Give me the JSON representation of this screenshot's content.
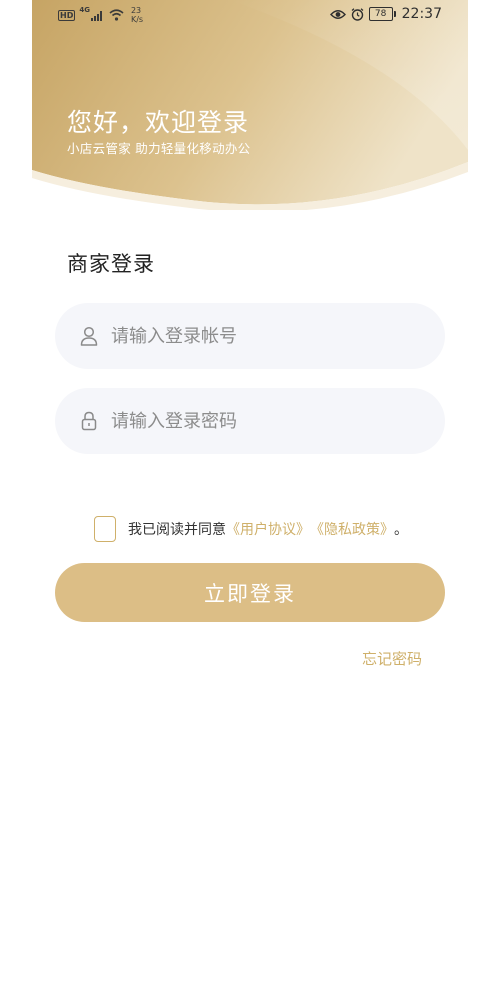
{
  "status_bar": {
    "hd": "HD",
    "network": "4G",
    "speed_value": "23",
    "speed_unit": "K/s",
    "battery": "78",
    "time": "22:37"
  },
  "header": {
    "greeting": "您好，欢迎登录",
    "slogan": "小店云管家 助力轻量化移动办公"
  },
  "login": {
    "title": "商家登录",
    "account_placeholder": "请输入登录帐号",
    "password_placeholder": "请输入登录密码",
    "agree_prefix": "我已阅读并同意",
    "user_agreement": "《用户协议》",
    "privacy_policy": "《隐私政策》",
    "agree_suffix": "。",
    "login_button": "立即登录",
    "forgot_password": "忘记密码"
  },
  "colors": {
    "accent": "#dcbe86",
    "link": "#cfb06a",
    "header_gradient_start": "#c9a968",
    "header_gradient_end": "#eee1c4",
    "field_bg": "#f5f6fa"
  },
  "icons": {
    "account": "user-icon",
    "password": "lock-icon",
    "signal": "signal-icon",
    "wifi": "wifi-icon",
    "eye": "eye-icon",
    "alarm": "alarm-icon"
  }
}
